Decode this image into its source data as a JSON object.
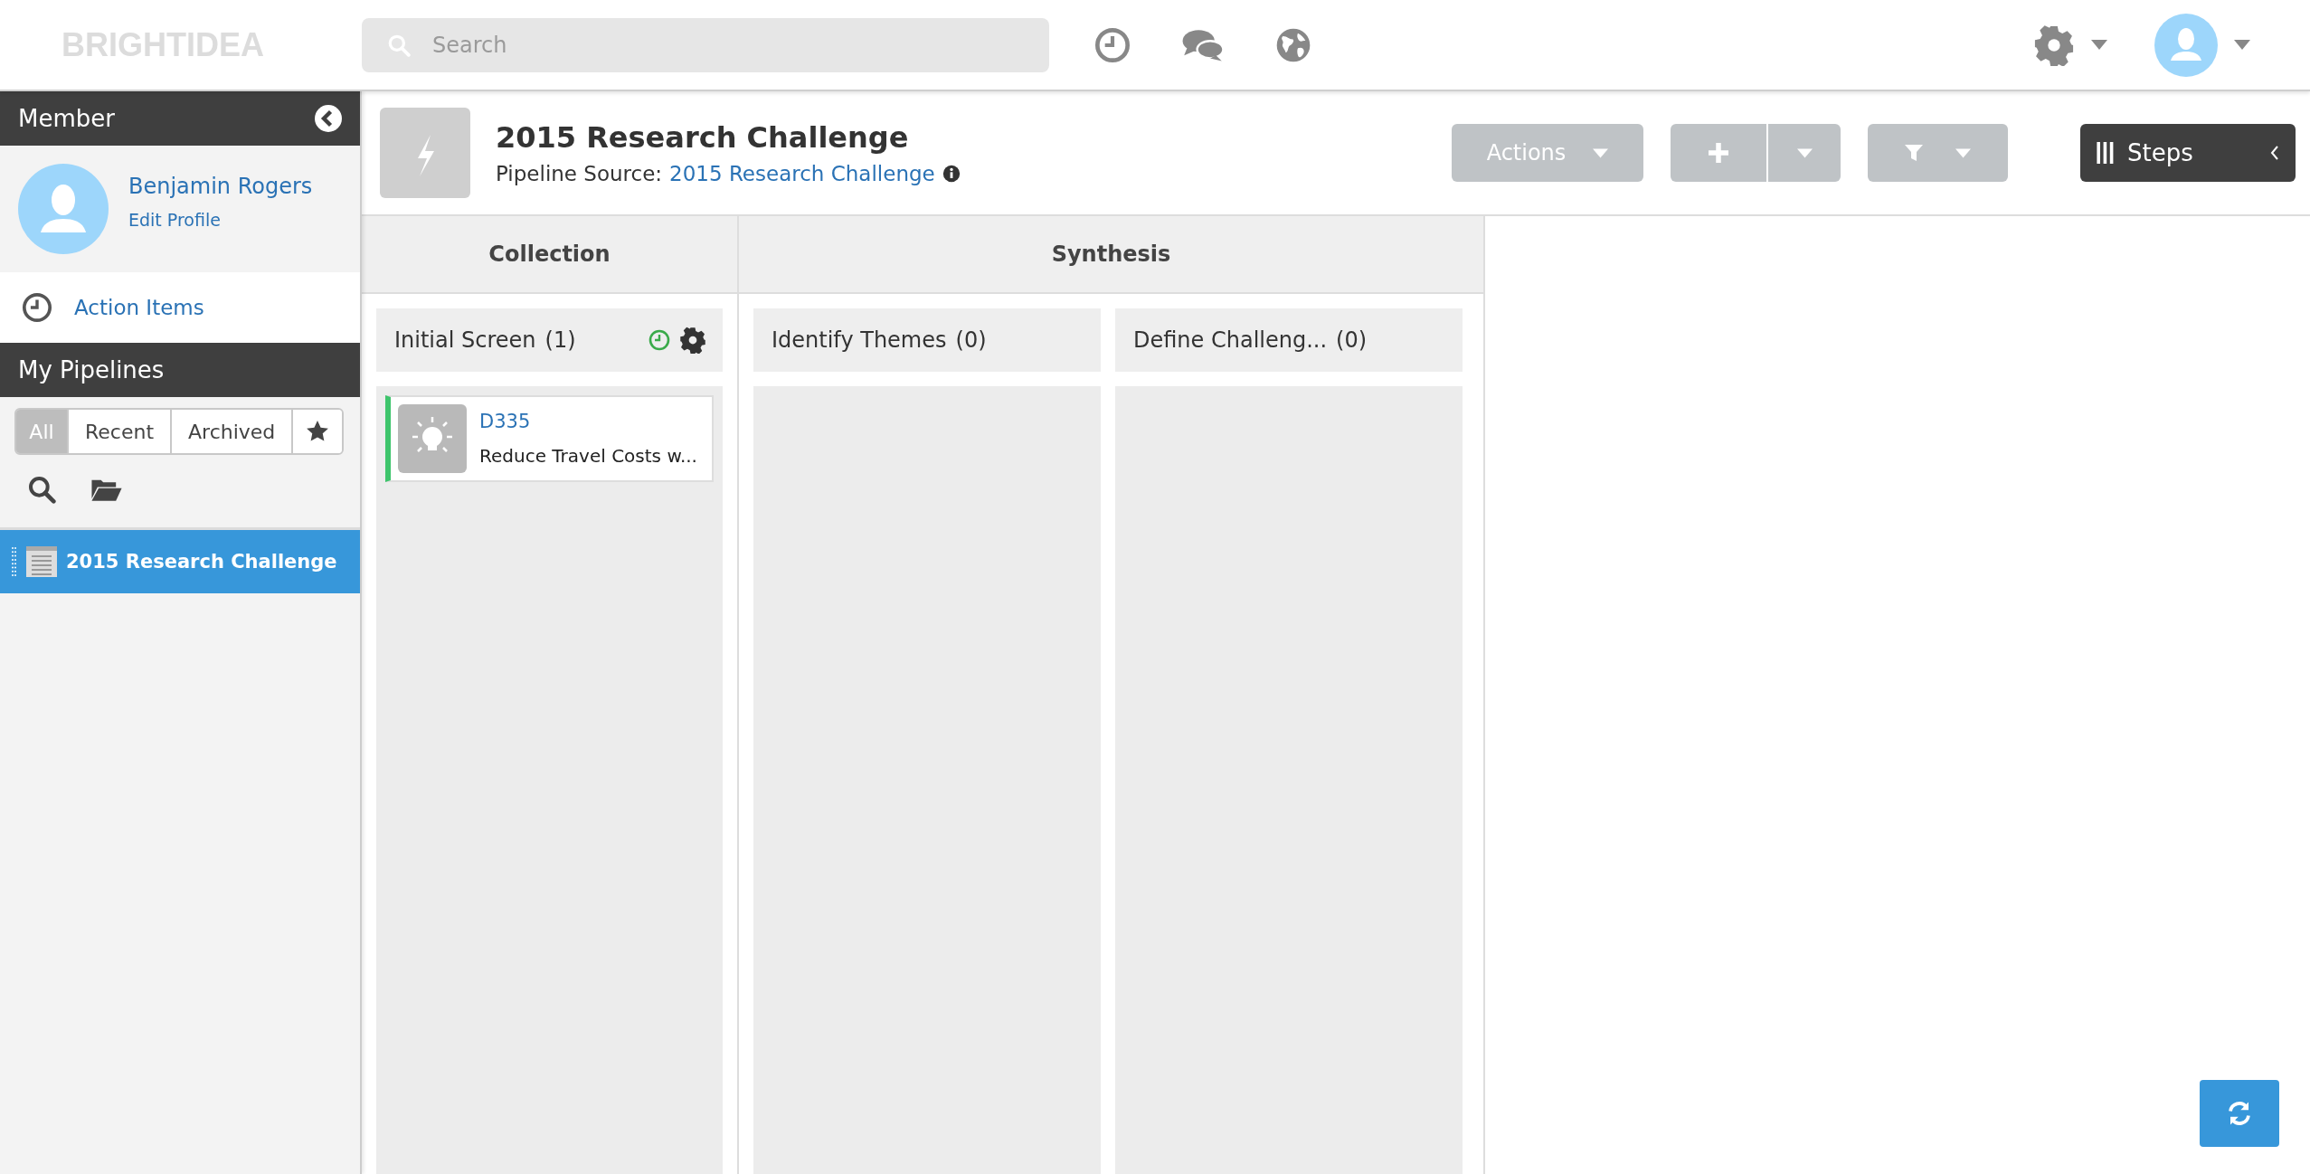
{
  "top_bar": {
    "logo": "BRIGHTIDEA",
    "search": {
      "placeholder": "Search"
    }
  },
  "sidebar": {
    "member_header": "Member",
    "profile": {
      "name": "Benjamin Rogers",
      "edit_link": "Edit Profile"
    },
    "action_items": "Action Items",
    "pipelines_header": "My Pipelines",
    "filter_tabs": [
      {
        "kind": "text",
        "label": "All",
        "selected": true
      },
      {
        "kind": "text",
        "label": "Recent",
        "selected": false
      },
      {
        "kind": "text",
        "label": "Archived",
        "selected": false
      },
      {
        "kind": "star",
        "selected": false
      }
    ],
    "pipelines": [
      {
        "name": "2015 Research Challenge",
        "selected": true
      }
    ]
  },
  "header": {
    "title": "2015 Research Challenge",
    "source_label": "Pipeline Source:",
    "source_link": "2015 Research Challenge"
  },
  "toolbar": {
    "actions": "Actions",
    "steps": "Steps"
  },
  "phases": [
    {
      "name": "Collection",
      "stages": [
        {
          "name": "Initial Screen",
          "count": "(1)",
          "active": true,
          "cards": [
            {
              "id": "D335",
              "title": "Reduce Travel Costs w..."
            }
          ]
        }
      ]
    },
    {
      "name": "Synthesis",
      "stages": [
        {
          "name": "Identify Themes",
          "count": "(0)",
          "active": false
        },
        {
          "name": "Define Challeng...",
          "count": "(0)",
          "active": false
        }
      ]
    }
  ]
}
